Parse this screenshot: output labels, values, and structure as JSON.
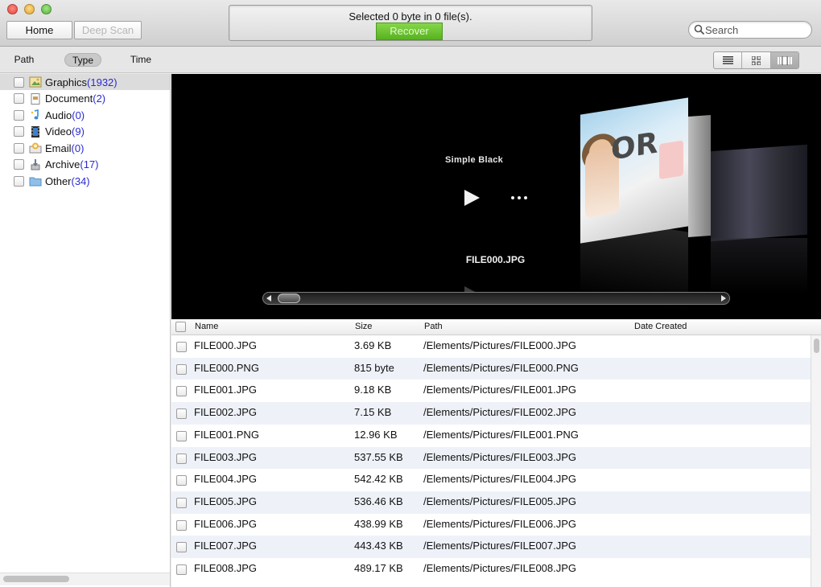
{
  "toolbar": {
    "home_label": "Home",
    "deep_scan_label": "Deep Scan",
    "status_text": "Selected 0 byte in 0 file(s).",
    "recover_label": "Recover",
    "search_placeholder": "Search"
  },
  "sort_tabs": {
    "path": "Path",
    "type": "Type",
    "time": "Time",
    "active": "Type"
  },
  "view_modes": [
    "list-view-icon",
    "grid-view-icon",
    "coverflow-view-icon"
  ],
  "active_view": "coverflow",
  "categories": [
    {
      "label": "Graphics",
      "count": "(1932)",
      "icon": "image-icon",
      "selected": true
    },
    {
      "label": "Document",
      "count": "(2)",
      "icon": "document-icon",
      "selected": false
    },
    {
      "label": "Audio",
      "count": "(0)",
      "icon": "music-note-icon",
      "selected": false
    },
    {
      "label": "Video",
      "count": "(9)",
      "icon": "film-icon",
      "selected": false
    },
    {
      "label": "Email",
      "count": "(0)",
      "icon": "email-icon",
      "selected": false
    },
    {
      "label": "Archive",
      "count": "(17)",
      "icon": "archive-icon",
      "selected": false
    },
    {
      "label": "Other",
      "count": "(34)",
      "icon": "folder-icon",
      "selected": false
    }
  ],
  "preview": {
    "title": "Simple Black",
    "filename": "FILE000.JPG",
    "card_text": "OR"
  },
  "columns": {
    "name": "Name",
    "size": "Size",
    "path": "Path",
    "date": "Date Created"
  },
  "files": [
    {
      "name": "FILE000.JPG",
      "size": "3.69 KB",
      "path": "/Elements/Pictures/FILE000.JPG"
    },
    {
      "name": "FILE000.PNG",
      "size": "815 byte",
      "path": "/Elements/Pictures/FILE000.PNG"
    },
    {
      "name": "FILE001.JPG",
      "size": "9.18 KB",
      "path": "/Elements/Pictures/FILE001.JPG"
    },
    {
      "name": "FILE002.JPG",
      "size": "7.15 KB",
      "path": "/Elements/Pictures/FILE002.JPG"
    },
    {
      "name": "FILE001.PNG",
      "size": "12.96 KB",
      "path": "/Elements/Pictures/FILE001.PNG"
    },
    {
      "name": "FILE003.JPG",
      "size": "537.55 KB",
      "path": "/Elements/Pictures/FILE003.JPG"
    },
    {
      "name": "FILE004.JPG",
      "size": "542.42 KB",
      "path": "/Elements/Pictures/FILE004.JPG"
    },
    {
      "name": "FILE005.JPG",
      "size": "536.46 KB",
      "path": "/Elements/Pictures/FILE005.JPG"
    },
    {
      "name": "FILE006.JPG",
      "size": "438.99 KB",
      "path": "/Elements/Pictures/FILE006.JPG"
    },
    {
      "name": "FILE007.JPG",
      "size": "443.43 KB",
      "path": "/Elements/Pictures/FILE007.JPG"
    },
    {
      "name": "FILE008.JPG",
      "size": "489.17 KB",
      "path": "/Elements/Pictures/FILE008.JPG"
    }
  ],
  "colors": {
    "recover_green": "#5fbd24",
    "count_blue": "#2a2ad4",
    "row_alt": "#eef2f8"
  }
}
